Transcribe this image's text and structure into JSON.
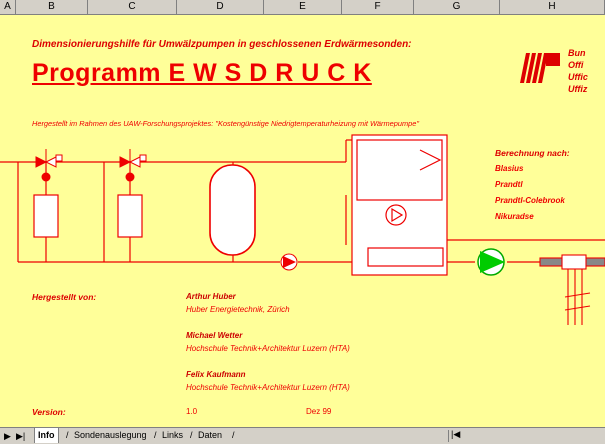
{
  "columns": [
    "A",
    "B",
    "C",
    "D",
    "E",
    "F",
    "G",
    "H"
  ],
  "subtitle": "Dimensionierungshilfe für Umwälzpumpen in geschlossenen Erdwärmesonden:",
  "title": "Programm  E W S D R U C K",
  "logo_lines": [
    "Bun",
    "Offi",
    "Uffic",
    "Uffiz"
  ],
  "project": "Hergestellt im Rahmen des UAW-Forschungsprojektes: \"Kostengünstige Niedrigtemperaturheizung mit Wärmepumpe\"",
  "calc": {
    "heading": "Berechnung nach:",
    "methods": [
      "Blasius",
      "Prandtl",
      "Prandtl-Colebrook",
      "Nikuradse"
    ]
  },
  "made_by_label": "Hergestellt von:",
  "persons": [
    {
      "name": "Arthur Huber",
      "org": "Huber Energietechnik, Zürich"
    },
    {
      "name": "Michael Wetter",
      "org": "Hochschule Technik+Architektur Luzern (HTA)"
    },
    {
      "name": "Felix Kaufmann",
      "org": "Hochschule Technik+Architektur Luzern (HTA)"
    }
  ],
  "version": {
    "label": "Version:",
    "value": "1.0",
    "date": "Dez 99"
  },
  "tabs": [
    "Info",
    "Sondenauslegung",
    "Links",
    "Daten"
  ],
  "colors": {
    "red": "#ee0000",
    "sheet_bg": "#ffff99",
    "pump_green": "#00cc00"
  }
}
